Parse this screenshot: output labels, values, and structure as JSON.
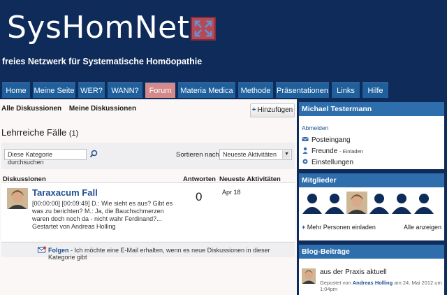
{
  "header": {
    "logo_text": "SysHomNet",
    "tagline": "freies Netzwerk für Systematische Homöopathie"
  },
  "nav": {
    "items": [
      {
        "label": "Home"
      },
      {
        "label": "Meine Seite"
      },
      {
        "label": "WER?"
      },
      {
        "label": "WANN?"
      },
      {
        "label": "Forum",
        "active": true
      },
      {
        "label": "Materia Medica"
      },
      {
        "label": "Methode"
      },
      {
        "label": "Präsentationen"
      },
      {
        "label": "Links"
      },
      {
        "label": "Hilfe"
      }
    ]
  },
  "main": {
    "subtabs": [
      "Alle Diskussionen",
      "Meine Diskussionen"
    ],
    "add_button": "Hinzufügen",
    "title": "Lehrreiche Fälle",
    "title_count": "(1)",
    "search_placeholder": "Diese Kategorie durchsuchen",
    "sort_label": "Sortieren nach:",
    "sort_value": "Neueste Aktivitäten",
    "columns": {
      "discussions": "Diskussionen",
      "replies": "Antworten",
      "latest": "Neueste Aktivitäten"
    },
    "topic": {
      "title": "Taraxacum Fall",
      "excerpt": "[00:00:00] [00:09:49] D.: Wie sieht es aus? Gibt es was zu berichten? M.: Ja, die Bauchschmerzen waren doch noch da - nicht wahr Ferdinand?...",
      "started_by": "Gestartet von Andreas Holling",
      "replies": "0",
      "date": "Apr 18"
    },
    "follow": {
      "label": "Folgen",
      "text": " - Ich möchte eine E-Mail erhalten, wenn es neue Diskussionen in dieser Kategorie gibt"
    }
  },
  "sidebar": {
    "user": {
      "name": "Michael Testermann",
      "logout": "Abmelden",
      "inbox": "Posteingang",
      "friends": "Freunde",
      "invite": "- Einladen",
      "settings": "Einstellungen"
    },
    "members": {
      "title": "Mitglieder",
      "invite": "Mehr Personen einladen",
      "show_all": "Alle anzeigen"
    },
    "blog": {
      "title": "Blog-Beiträge",
      "post_title": "aus der Praxis aktuell",
      "meta_prefix": "Gepostet von",
      "author": "Andreas Holling",
      "meta_suffix": "am 24. Mai 2012 um 1:04pm"
    }
  },
  "colors": {
    "header_bg": "#0e2b5a",
    "nav_bg": "#1f5f9c",
    "nav_active": "#d48a8a",
    "box_head": "#2f6ead",
    "link": "#1f4f8f"
  }
}
